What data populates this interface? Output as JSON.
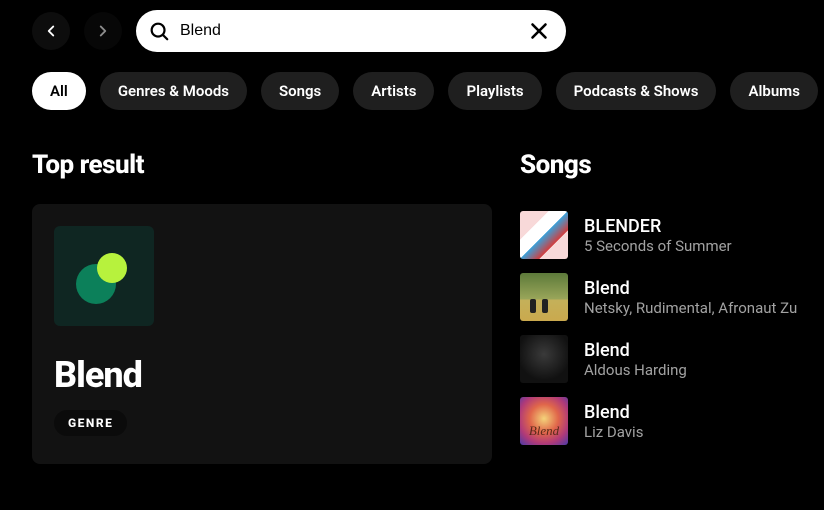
{
  "search": {
    "value": "Blend"
  },
  "filters": [
    {
      "label": "All",
      "active": true
    },
    {
      "label": "Genres & Moods",
      "active": false
    },
    {
      "label": "Songs",
      "active": false
    },
    {
      "label": "Artists",
      "active": false
    },
    {
      "label": "Playlists",
      "active": false
    },
    {
      "label": "Podcasts & Shows",
      "active": false
    },
    {
      "label": "Albums",
      "active": false
    }
  ],
  "sections": {
    "top_result_heading": "Top result",
    "songs_heading": "Songs"
  },
  "top_result": {
    "title": "Blend",
    "tag": "GENRE"
  },
  "songs": [
    {
      "title": "BLENDER",
      "artist": "5 Seconds of Summer"
    },
    {
      "title": "Blend",
      "artist": "Netsky, Rudimental, Afronaut Zu"
    },
    {
      "title": "Blend",
      "artist": "Aldous Harding"
    },
    {
      "title": "Blend",
      "artist": "Liz Davis"
    }
  ]
}
